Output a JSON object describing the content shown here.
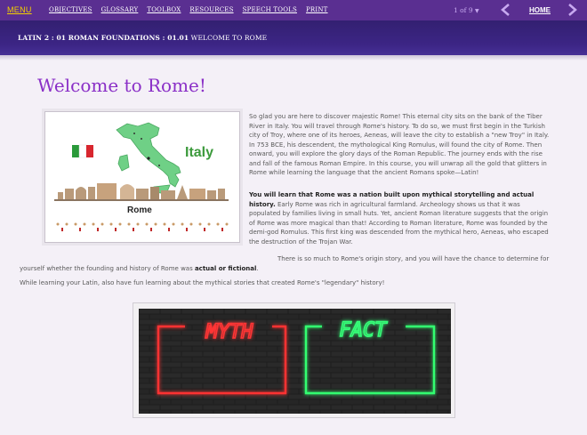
{
  "nav": {
    "menu": "MENU",
    "links": [
      "OBJECTIVES",
      "GLOSSARY",
      "TOOLBOX",
      "RESOURCES",
      "SPEECH TOOLS",
      "PRINT"
    ],
    "pager": "1 of 9",
    "home": "HOME"
  },
  "breadcrumb": {
    "course": "LATIN 2 : 01 ROMAN FOUNDATIONS : 01.01",
    "page": "WELCOME TO ROME"
  },
  "page_title": "Welcome to Rome!",
  "figure": {
    "country_label": "Italy",
    "city_label": "Rome"
  },
  "paragraphs": {
    "p1": "So glad you are here to discover majestic Rome! This eternal city sits on the bank of the Tiber River in Italy. You will travel through Rome's history. To do so, we must first begin in the Turkish city of Troy, where one of its heroes, Aeneas, will leave the city to establish a \"new Troy\" in Italy. In 753 BCE, his descendent, the mythological King Romulus, will found the city of Rome. Then onward, you will explore the glory days of the Roman Republic. The journey ends with the rise and fall of the famous Roman Empire. In this course, you will unwrap all the gold that glitters in Rome while learning the language that the ancient Romans spoke—Latin!",
    "p2_bold": "You will learn that Rome was a nation built upon mythical storytelling and actual history.",
    "p2_rest": " Early Rome was rich in agricultural farmland. Archeology shows us that it was populated by families living in small huts. Yet, ancient Roman literature suggests that the origin of Rome was more magical than that! According to Roman literature, Rome was founded by the demi-god Romulus. This first king was descended from the mythical hero, Aeneas, who escaped the destruction of the Trojan War.",
    "p3_start": "There is so much to Rome's origin story, and you will have the chance to determine for yourself whether the founding and history of Rome was ",
    "p3_bold": "actual or fictional",
    "p3_end": ".",
    "p4": "While learning your Latin, also have fun learning about the mythical stories that created Rome's \"legendary\" history!"
  },
  "neon_sign": {
    "left_word": "MYTH",
    "right_word": "FACT"
  },
  "colors": {
    "nav_bg": "#5a2f91",
    "menu": "#f4d000",
    "title": "#8a2fc7",
    "banner": "#3c2585",
    "neon_red": "#ff2a2a",
    "neon_green": "#2cff6a"
  }
}
